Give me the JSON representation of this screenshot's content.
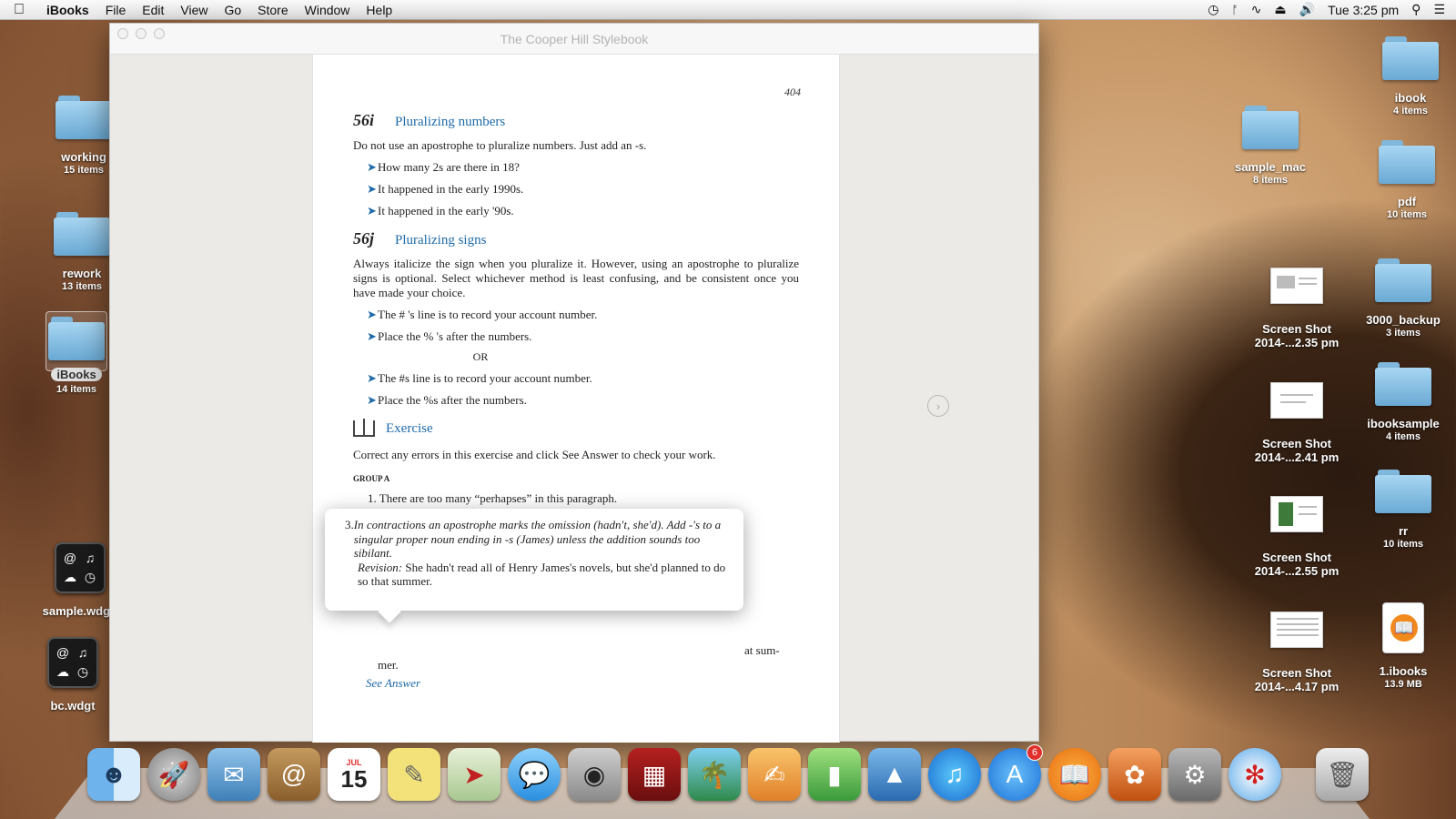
{
  "menubar": {
    "apple": "",
    "app": "iBooks",
    "items": [
      "File",
      "Edit",
      "View",
      "Go",
      "Store",
      "Window",
      "Help"
    ],
    "clock": "Tue 3:25 pm"
  },
  "desktop_left": [
    {
      "name": "working",
      "sub": "15 items"
    },
    {
      "name": "rework",
      "sub": "13 items"
    },
    {
      "name": "iBooks",
      "sub": "14 items"
    },
    {
      "name": "sample.wdgt",
      "sub": ""
    },
    {
      "name": "bc.wdgt",
      "sub": ""
    }
  ],
  "desktop_right": [
    {
      "name": "ibook",
      "sub": "4 items"
    },
    {
      "name": "sample_mac",
      "sub": "8 items"
    },
    {
      "name": "pdf",
      "sub": "10 items"
    },
    {
      "name": "Screen Shot",
      "sub": "2014-...2.35 pm"
    },
    {
      "name": "3000_backup",
      "sub": "3 items"
    },
    {
      "name": "Screen Shot",
      "sub": "2014-...2.41 pm"
    },
    {
      "name": "ibooksample",
      "sub": "4 items"
    },
    {
      "name": "Screen Shot",
      "sub": "2014-...2.55 pm"
    },
    {
      "name": "rr",
      "sub": "10 items"
    },
    {
      "name": "Screen Shot",
      "sub": "2014-...4.17 pm"
    },
    {
      "name": "1.ibooks",
      "sub": "13.9 MB"
    }
  ],
  "window": {
    "title": "The Cooper Hill Stylebook",
    "page_number": "404"
  },
  "book": {
    "sec1": {
      "num": "56i",
      "title": "Pluralizing numbers",
      "intro": "Do not use an apostrophe to pluralize numbers. Just add an -s.",
      "bullets": [
        "How many 2s are there in 18?",
        "It happened in the early 1990s.",
        "It happened in the early '90s."
      ]
    },
    "sec2": {
      "num": "56j",
      "title": "Pluralizing signs",
      "intro": "Always italicize the sign when you pluralize it. However, using an apostrophe to pluralize signs is optional. Select whichever method is least confusing, and be consistent once you have made your choice.",
      "bullets": [
        "The # 's line is to record your account number.",
        "Place the % 's after the numbers.",
        "The #s line is to record your account number.",
        "Place the %s after the numbers."
      ],
      "or": "OR"
    },
    "exercise": {
      "title": "Exercise",
      "intro": "Correct any errors in this exercise and click See Answer to check your work.",
      "group": "GROUP A",
      "item1": "1. There are too many “perhapses” in this paragraph.",
      "behind_tail": "at sum-",
      "behind_tail2": "mer.",
      "see_answer": "See Answer"
    },
    "popover": {
      "num": "3.",
      "answer": "In contractions an apostrophe marks the omission (hadn't, she'd). Add -'s to a singular proper noun ending in -s (James) unless the addition sounds too sibilant.",
      "rev_label": "Revision:",
      "revision": " She hadn't read all of Henry James's novels, but she'd planned to do so that summer."
    }
  },
  "dock": {
    "apps": [
      "Finder",
      "Launchpad",
      "Mail",
      "Contacts",
      "Calendar",
      "Stickies",
      "Maps",
      "Messages",
      "FaceTime",
      "Photo Booth",
      "iPhoto",
      "Pages",
      "Numbers",
      "Keynote",
      "iTunes",
      "App Store",
      "iBooks",
      "Pixelmator",
      "System Preferences",
      "Safari",
      "Trash"
    ],
    "calendar_day": "15",
    "calendar_month": "JUL",
    "appstore_badge": "6"
  },
  "colors": {
    "accent": "#1e6aa8",
    "folder": "#8cc4e8",
    "badge": "#e0302b"
  }
}
